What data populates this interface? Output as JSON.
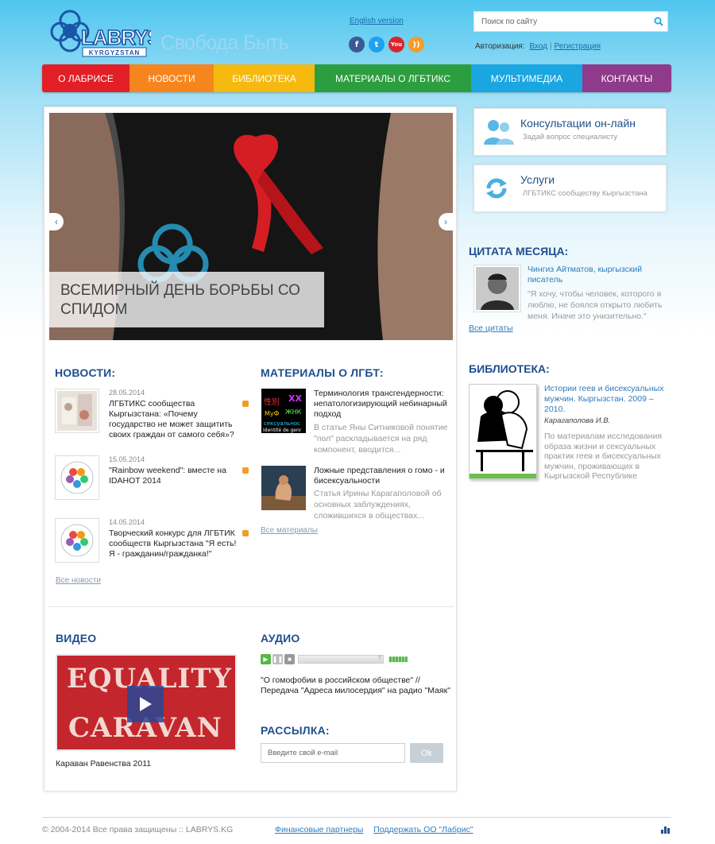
{
  "header": {
    "logo_text": "LABRYS",
    "logo_sub": "KYRGYZSTAN",
    "slogan": "Свобода Быть",
    "english_link": "English version",
    "social": [
      {
        "name": "facebook-icon",
        "glyph": "f",
        "color": "#3b5998"
      },
      {
        "name": "twitter-icon",
        "glyph": "t",
        "color": "#1da1f2"
      },
      {
        "name": "youtube-icon",
        "glyph": "You",
        "color": "#d8262c"
      },
      {
        "name": "rss-icon",
        "glyph": "))",
        "color": "#f39c2b"
      }
    ],
    "search_placeholder": "Поиск по сайту",
    "auth_label": "Авторизация:",
    "login_link": "Вход",
    "auth_separator": "|",
    "register_link": "Регистрация"
  },
  "nav": [
    {
      "label": "О Лабрисе",
      "color": "#e21f26",
      "width": 110
    },
    {
      "label": "Новости",
      "color": "#f7851e",
      "width": 106
    },
    {
      "label": "Библиотека",
      "color": "#f6b90f",
      "width": 127
    },
    {
      "label": "Материалы о ЛГБТИКС",
      "color": "#2c9e3f",
      "width": 197
    },
    {
      "label": "Мультимедиа",
      "color": "#1aa6e0",
      "width": 140
    },
    {
      "label": "Контакты",
      "color": "#8f3a8b",
      "width": 112
    }
  ],
  "slider": {
    "caption": "Всемирный день борьбы со спидом"
  },
  "news": {
    "title": "Новости:",
    "items": [
      {
        "date": "28.05.2014",
        "title": "ЛГБТИКС сообщества Кыргызстана: «Почему государство не может защитить своих граждан от самого себя»?"
      },
      {
        "date": "15.05.2014",
        "title": "\"Rainbow weekend\": вместе на IDAHOT 2014"
      },
      {
        "date": "14.05.2014",
        "title": "Творческий конкурс для ЛГБТИК сообществ Кыргызстана \"Я есть! Я - гражданин/гражданка!\""
      }
    ],
    "more": "Все новости"
  },
  "materials": {
    "title": "Материалы о ЛГБТ:",
    "items": [
      {
        "title": "Терминология трансгендерности: непатологизирующий небинарный подход",
        "desc": "В статье Яны Ситниковой понятие \"пол\" раскладывается на ряд компонент, вводится..."
      },
      {
        "title": "Ложные представления о гомо - и бисексуальности",
        "desc": "Статья Ирины Карагаполовой об основных заблуждениях, сложившихся в обществах..."
      }
    ],
    "more": "Все материалы"
  },
  "video": {
    "title": "Видео",
    "caption": "Караван Равенства 2011",
    "thumb_line1": "EQUALITY",
    "thumb_line2": "CARAVAN"
  },
  "audio": {
    "title": "Аудио",
    "caption": "\"О гомофобии в российском обществе\" // Передача \"Адреса милосердия\" на радио \"Маяк\"",
    "unknown_time": "?"
  },
  "newsletter": {
    "title": "Рассылка:",
    "placeholder": "Введите свой e-mail",
    "button": "Ok"
  },
  "widgets": [
    {
      "title": "Консультации он-лайн",
      "subtitle": "Задай вопрос специалисту"
    },
    {
      "title": "Услуги",
      "subtitle": "ЛГБТИКС сообществу Кыргызстана"
    }
  ],
  "quote": {
    "title": "Цитата месяца:",
    "author": "Чингиз Айтматов, кыргызский писатель",
    "text": "\"Я хочу, чтобы человек, которого я люблю, не боялся открыто любить меня. Иначе это унизительно.\"",
    "more": "Все цитаты"
  },
  "library": {
    "title": "Библиотека:",
    "book_title": "Истории геев и бисексуальных мужчин. Кыргызстан. 2009 – 2010.",
    "author": "Карагаполова И.В.",
    "desc": "По материалам исследования образа жизни и сексуальных практик геев и бисексуальных мужчин, проживающих в Кыргызской Республике"
  },
  "footer": {
    "copyright": "© 2004-2014 Все права защищены :: LABRYS.KG",
    "links": [
      "Финансовые партнеры",
      "Поддержать ОО \"Лабрис\""
    ]
  }
}
